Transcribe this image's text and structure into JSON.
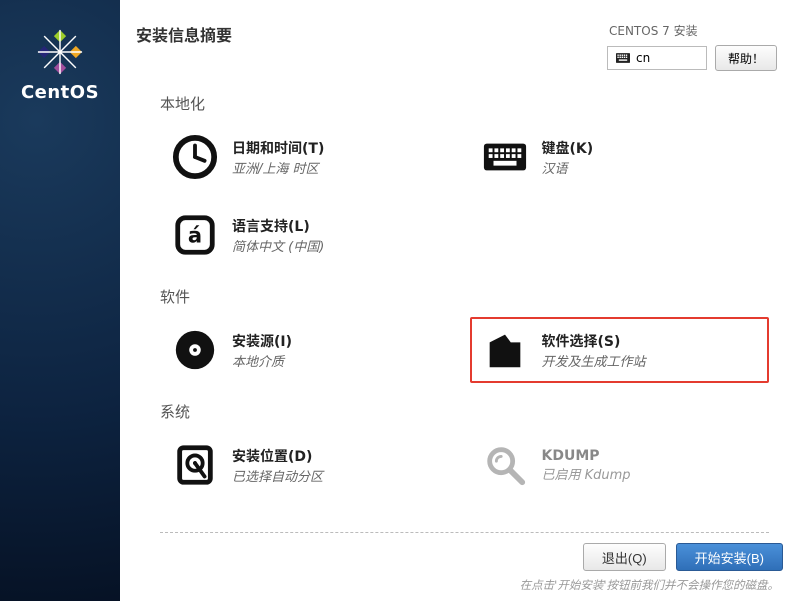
{
  "brand": "CentOS",
  "header": {
    "title": "安装信息摘要",
    "install_label": "CENTOS 7 安装",
    "layout_indicator": "cn",
    "help_label": "帮助！"
  },
  "sections": {
    "localization": {
      "title": "本地化",
      "datetime": {
        "title": "日期和时间(T)",
        "sub": "亚洲/上海 时区"
      },
      "keyboard": {
        "title": "键盘(K)",
        "sub": "汉语"
      },
      "language": {
        "title": "语言支持(L)",
        "sub": "简体中文 (中国)"
      }
    },
    "software": {
      "title": "软件",
      "source": {
        "title": "安装源(I)",
        "sub": "本地介质"
      },
      "selection": {
        "title": "软件选择(S)",
        "sub": "开发及生成工作站"
      }
    },
    "system": {
      "title": "系统",
      "destination": {
        "title": "安装位置(D)",
        "sub": "已选择自动分区"
      },
      "kdump": {
        "title": "KDUMP",
        "sub": "已启用 Kdump"
      }
    }
  },
  "footer": {
    "quit": "退出(Q)",
    "begin": "开始安装(B)",
    "hint": "在点击'开始安装'按钮前我们并不会操作您的磁盘。"
  }
}
